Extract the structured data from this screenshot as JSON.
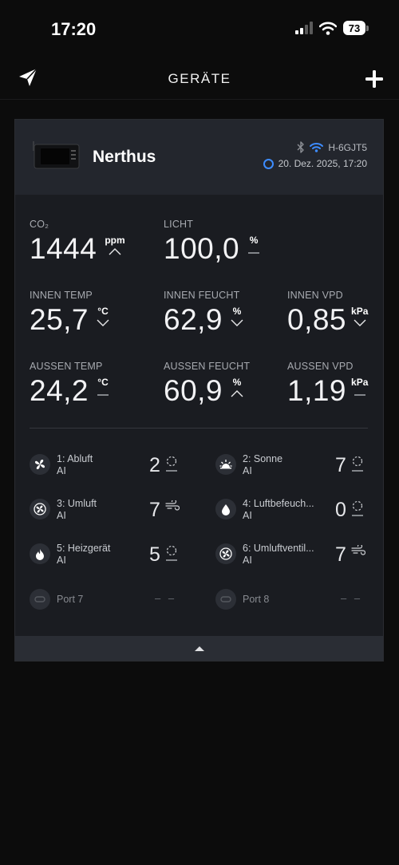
{
  "status_bar": {
    "time": "17:20",
    "battery": "73"
  },
  "nav": {
    "title": "GERÄTE",
    "add_icon": "plus-icon",
    "logo_icon": "paper-plane-logo-icon"
  },
  "device": {
    "name": "Nerthus",
    "device_id": "H-6GJT5",
    "last_update": "20. Dez. 2025, 17:20",
    "accent_color": "#3d8cff"
  },
  "sensors": {
    "co2": {
      "label": "CO₂",
      "value": "1444",
      "unit": "ppm",
      "trend": "up"
    },
    "light": {
      "label": "LICHT",
      "value": "100,0",
      "unit": "%",
      "trend": "flat"
    },
    "in_temp": {
      "label": "INNEN TEMP",
      "value": "25,7",
      "unit": "°C",
      "trend": "down"
    },
    "in_hum": {
      "label": "INNEN FEUCHT",
      "value": "62,9",
      "unit": "%",
      "trend": "down"
    },
    "in_vpd": {
      "label": "INNEN VPD",
      "value": "0,85",
      "unit": "kPa",
      "trend": "down"
    },
    "out_temp": {
      "label": "AUSSEN TEMP",
      "value": "24,2",
      "unit": "°C",
      "trend": "flat"
    },
    "out_hum": {
      "label": "AUSSEN FEUCHT",
      "value": "60,9",
      "unit": "%",
      "trend": "up"
    },
    "out_vpd": {
      "label": "AUSSEN VPD",
      "value": "1,19",
      "unit": "kPa",
      "trend": "flat"
    }
  },
  "ports": [
    {
      "name": "1: Abluft",
      "mode": "AI",
      "level": "2",
      "icon": "fan-icon",
      "status_icon": "dashed-circle-icon"
    },
    {
      "name": "2: Sonne",
      "mode": "AI",
      "level": "7",
      "icon": "sun-icon",
      "status_icon": "dashed-circle-icon"
    },
    {
      "name": "3: Umluft",
      "mode": "AI",
      "level": "7",
      "icon": "circulation-fan-icon",
      "status_icon": "wind-icon"
    },
    {
      "name": "4: Luftbefeuch...",
      "mode": "AI",
      "level": "0",
      "icon": "water-drop-icon",
      "status_icon": "dashed-circle-icon"
    },
    {
      "name": "5: Heizgerät",
      "mode": "AI",
      "level": "5",
      "icon": "flame-icon",
      "status_icon": "dashed-circle-icon"
    },
    {
      "name": "6: Umluftventil...",
      "mode": "AI",
      "level": "7",
      "icon": "circulation-fan-icon",
      "status_icon": "wind-icon"
    },
    {
      "name": "Port 7",
      "dash": "– –",
      "icon": "empty-port-icon"
    },
    {
      "name": "Port 8",
      "dash": "– –",
      "icon": "empty-port-icon"
    }
  ],
  "footer": {
    "icon": "collapse-up-icon"
  }
}
